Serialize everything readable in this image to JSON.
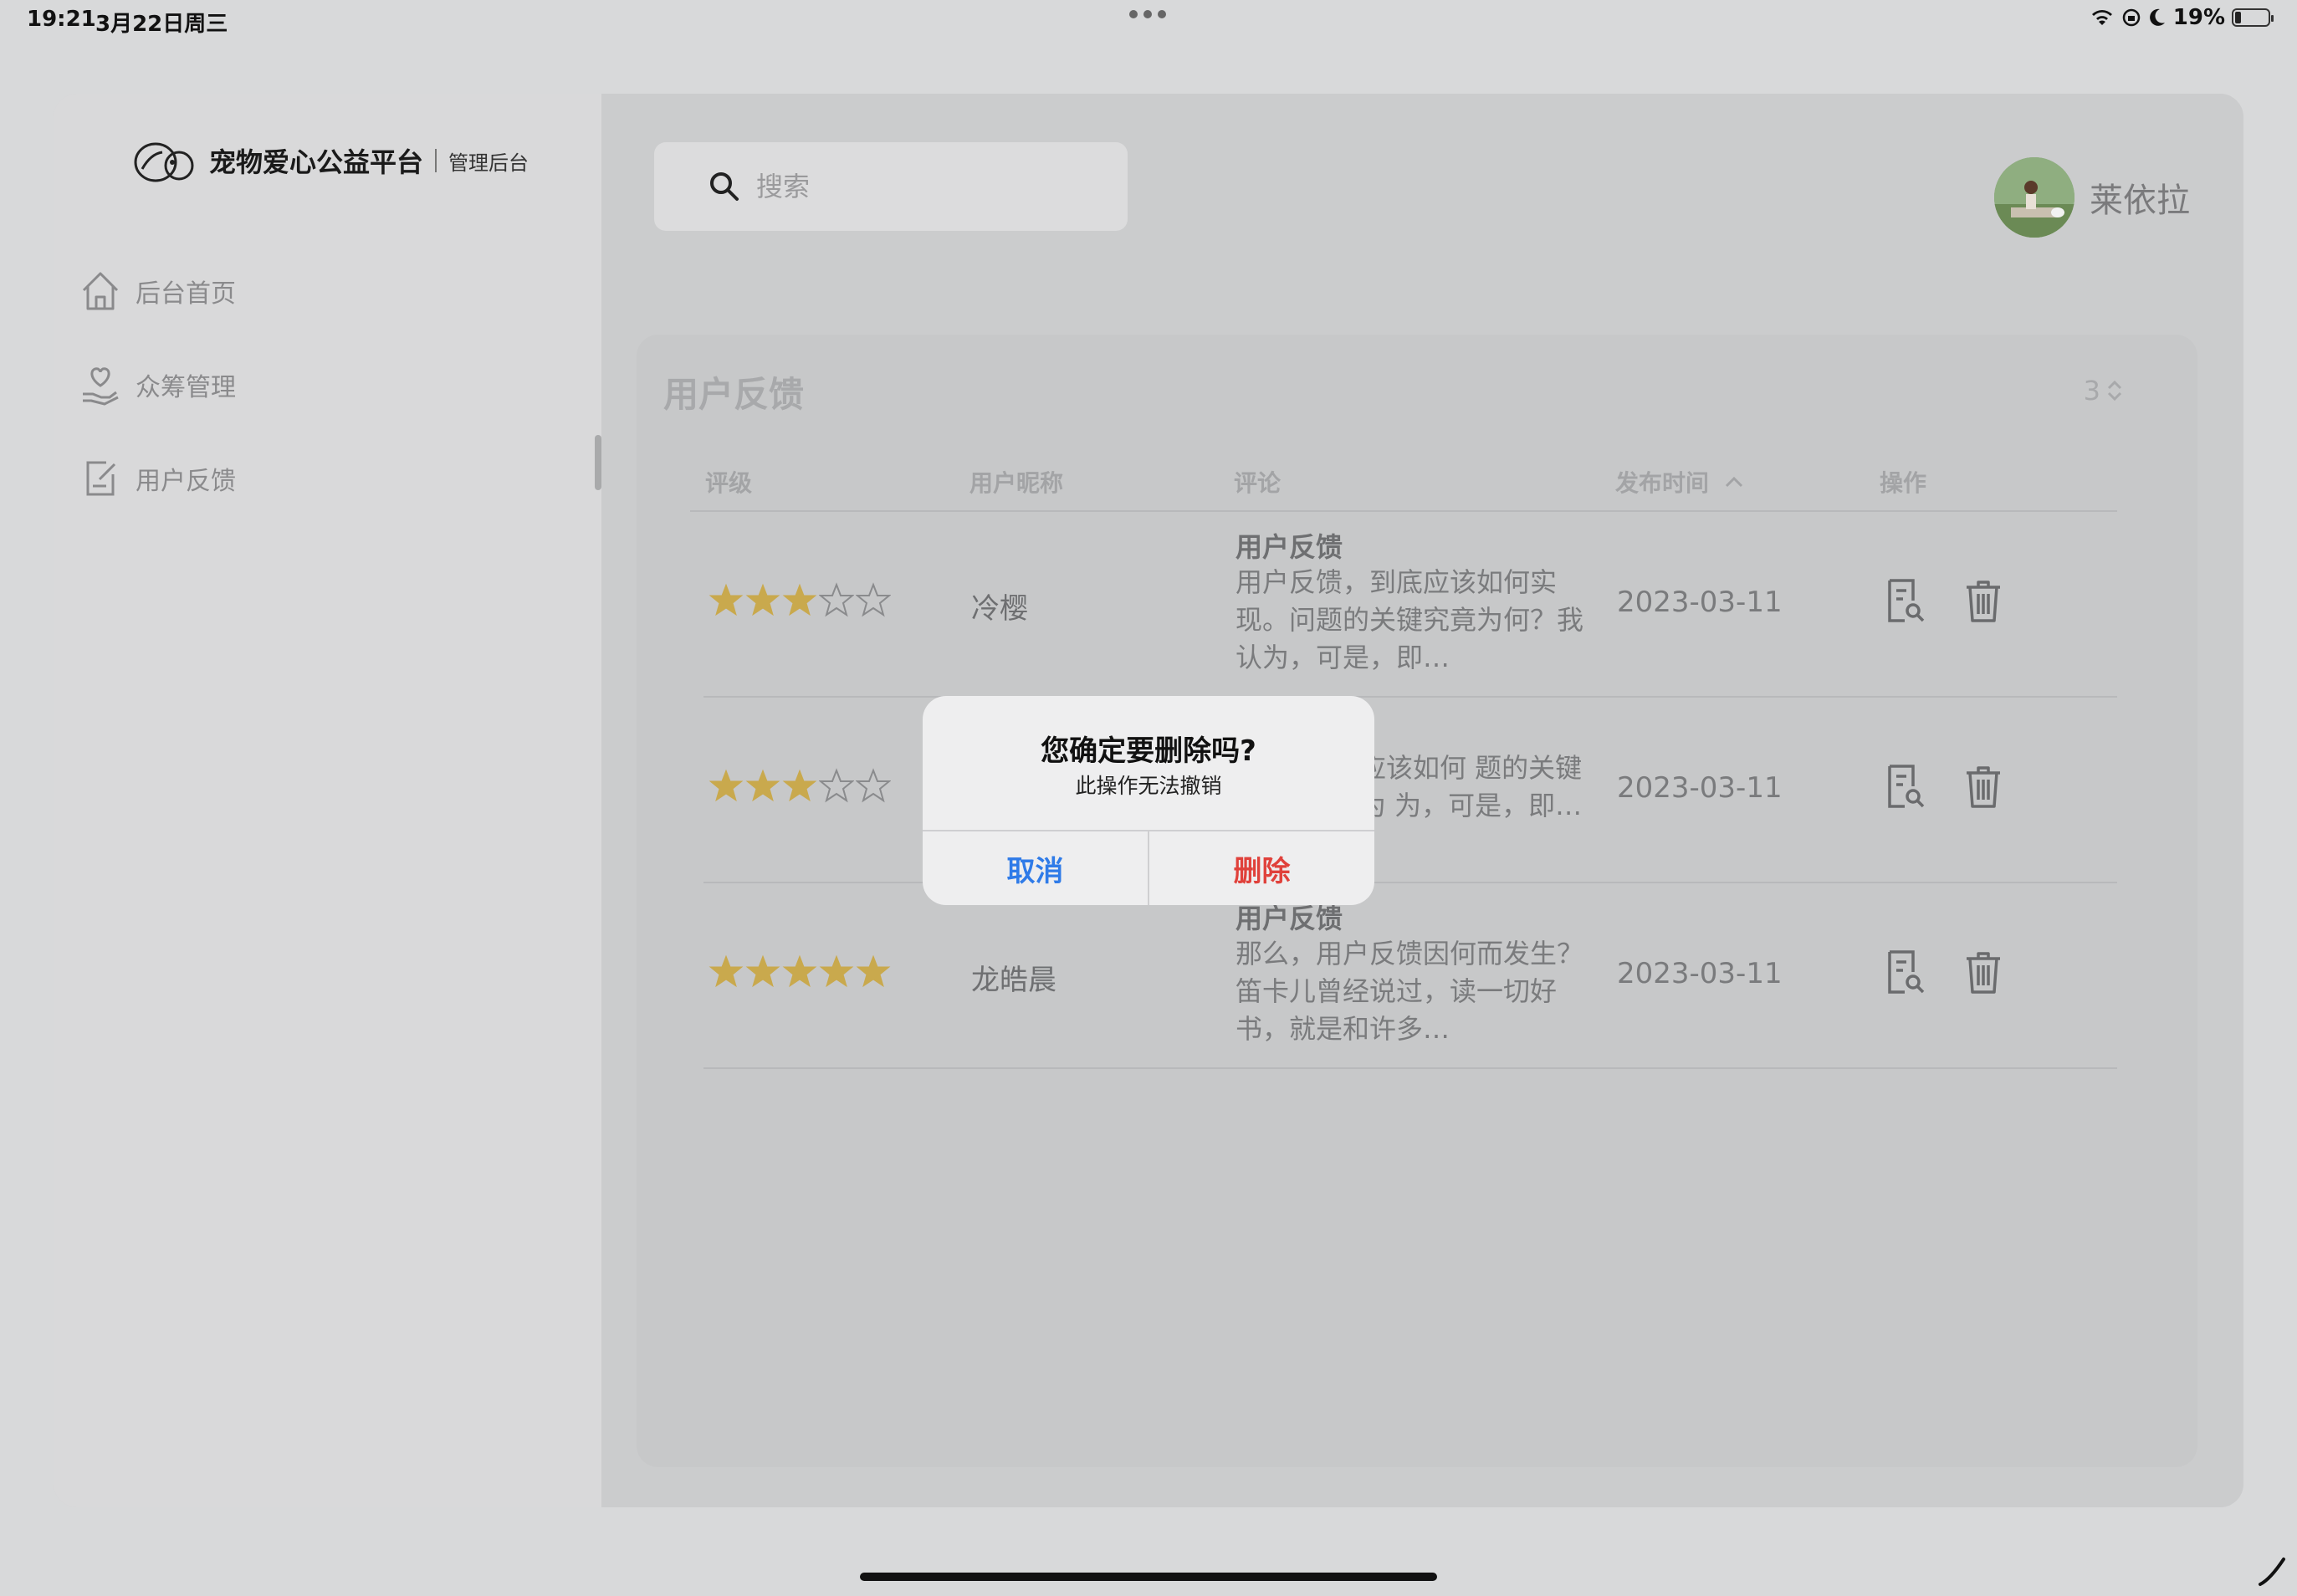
{
  "status_bar": {
    "time": "19:21",
    "date": "3月22日周三",
    "battery_pct": "19%",
    "battery_level": 0.19
  },
  "app": {
    "brand_title": "宠物爱心公益平台",
    "brand_sub": "管理后台"
  },
  "sidebar": {
    "items": [
      {
        "label": "后台首页",
        "icon": "home-icon"
      },
      {
        "label": "众筹管理",
        "icon": "heart-hand-icon"
      },
      {
        "label": "用户反馈",
        "icon": "edit-note-icon",
        "active": true
      }
    ]
  },
  "search": {
    "placeholder": "搜索"
  },
  "user": {
    "name": "莱依拉"
  },
  "card": {
    "title": "用户反馈",
    "pager_value": "3",
    "columns": [
      "评级",
      "用户昵称",
      "评论",
      "发布时间",
      "操作"
    ],
    "rows": [
      {
        "rating": 3,
        "nickname": "冷樱",
        "comment_title": "用户反馈",
        "comment_body": "用户反馈，到底应该如何实现。问题的关键究竟为何？我认为，可是，即…",
        "date": "2023-03-11"
      },
      {
        "rating": 3,
        "nickname": "",
        "comment_title": "",
        "comment_body": "到底应该如何 题的关键究竟为 为，可是，即…",
        "date": "2023-03-11"
      },
      {
        "rating": 5,
        "nickname": "龙皓晨",
        "comment_title": "用户反馈",
        "comment_body": "那么，用户反馈因何而发生？笛卡儿曾经说过，读一切好书，就是和许多…",
        "date": "2023-03-11"
      }
    ]
  },
  "dialog": {
    "title": "您确定要删除吗?",
    "message": "此操作无法撤销",
    "cancel_label": "取消",
    "delete_label": "删除"
  },
  "colors": {
    "accent_blue": "#2f7be8",
    "danger_red": "#e0413b",
    "star_gold": "#c9a94d"
  }
}
